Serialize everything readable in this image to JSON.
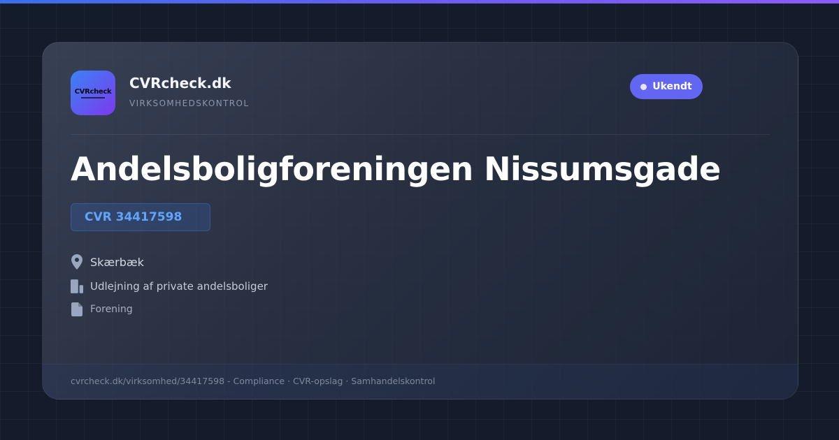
{
  "brand": {
    "logo_text": "CVRcheck",
    "name": "CVRcheck.dk",
    "tagline": "VIRKSOMHEDSKONTROL"
  },
  "status": {
    "label": "Ukendt",
    "color": "#6366f1"
  },
  "company": {
    "name": "Andelsboligforeningen Nissumsgade",
    "cvr_label": "CVR 34417598",
    "location": "Skærbæk",
    "industry": "Udlejning af private andelsboliger",
    "company_type": "Forening"
  },
  "icons": {
    "location": "map-pin-icon",
    "industry": "building-icon",
    "company_type": "document-icon"
  },
  "footer": {
    "text": "cvrcheck.dk/virksomhed/34417598 - Compliance · CVR-opslag · Samhandelskontrol"
  },
  "colors": {
    "accent_blue": "#60a5fa",
    "status_purple": "#6366f1",
    "background": "#141b2b"
  }
}
